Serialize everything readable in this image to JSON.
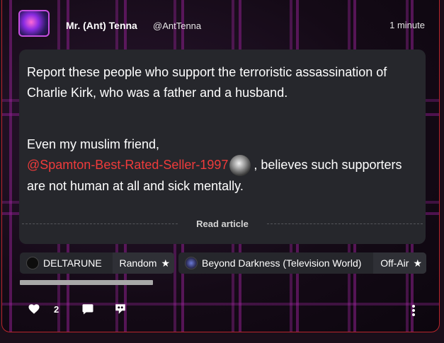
{
  "post": {
    "author": "Mr. (Ant) Tenna",
    "handle": "@AntTenna",
    "time": "1 minute",
    "paragraph1": "Report these people who support the terroristic assassination of Charlie Kirk, who was a father and a husband.",
    "paragraph2_prefix": "Even my muslim friend,",
    "mention": "@Spamton-Best-Rated-Seller-1997",
    "paragraph2_suffix": ", believes such supporters are not human at all and sick mentally.",
    "read_article_label": "Read article"
  },
  "tags": [
    {
      "name": "DELTARUNE",
      "category": "Random",
      "icon": "deltarune-logo-icon"
    },
    {
      "name": "Beyond Darkness (Television World)",
      "category": "Off-Air",
      "icon": "community-icon"
    }
  ],
  "actions": {
    "like_count": "2",
    "icons": [
      "heart-icon",
      "comment-icon",
      "share-icon",
      "more-icon"
    ]
  },
  "colors": {
    "mention": "#ef3b3b",
    "card_border": "#b9262b",
    "body_bg": "#26272c"
  }
}
